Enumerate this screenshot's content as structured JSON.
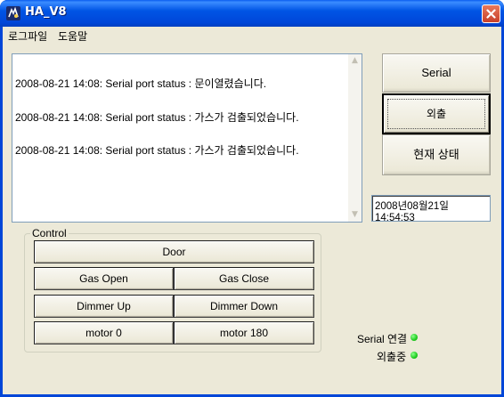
{
  "window": {
    "title": "HA_V8"
  },
  "menu": {
    "items": [
      "로그파일",
      "도움말"
    ]
  },
  "log": {
    "lines": [
      "2008-08-21 14:08: Serial port status : 문이열렸습니다.",
      "2008-08-21 14:08: Serial port status : 가스가 검출되었습니다.",
      "2008-08-21 14:08: Serial port status : 가스가 검출되었습니다."
    ]
  },
  "buttons": {
    "serial": "Serial",
    "outing": "외출",
    "current_status": "현재 상태"
  },
  "datetime": "2008년08월21일  14:54:53",
  "control": {
    "label": "Control",
    "door": "Door",
    "gas_open": "Gas Open",
    "gas_close": "Gas Close",
    "dimmer_up": "Dimmer Up",
    "dimmer_down": "Dimmer Down",
    "motor_0": "motor 0",
    "motor_180": "motor 180"
  },
  "status": {
    "serial_connection": "Serial 연결",
    "outing_mode": "외출중",
    "indicator_color": "#22cc22"
  }
}
